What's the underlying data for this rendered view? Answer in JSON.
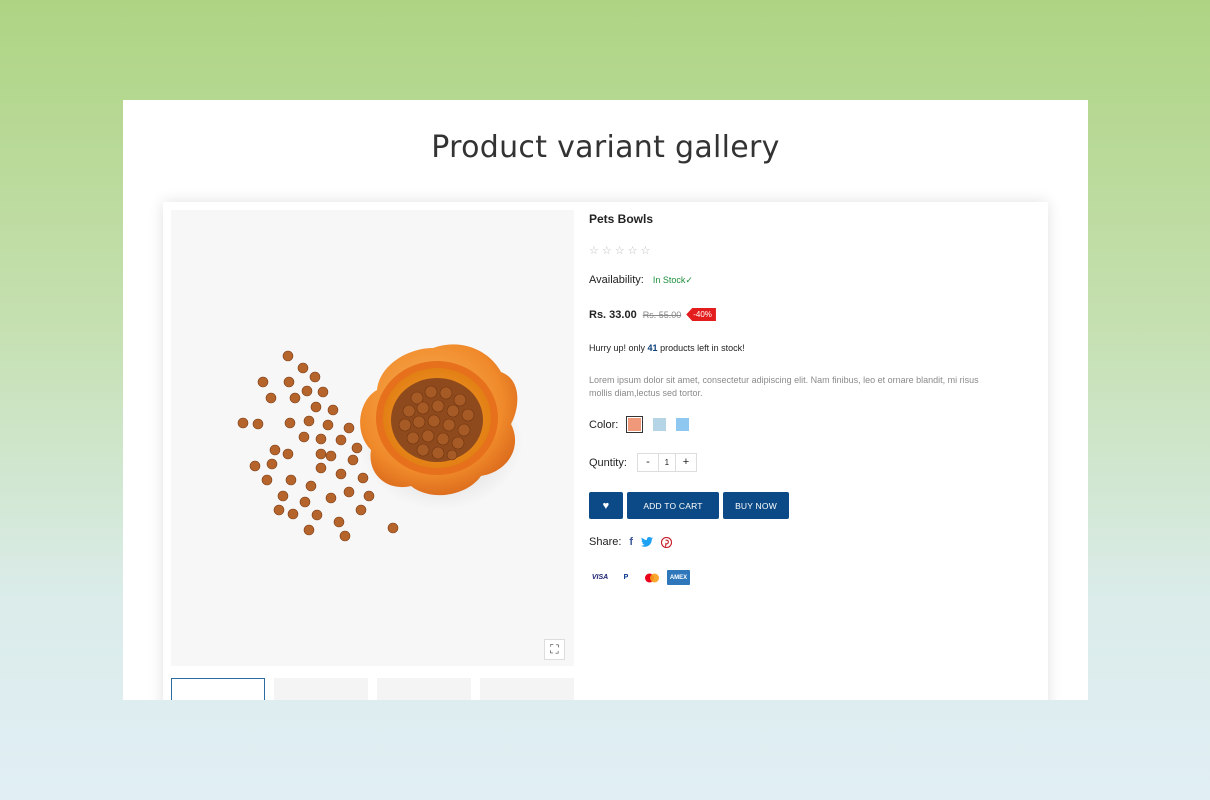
{
  "page": {
    "title": "Product variant gallery"
  },
  "product": {
    "title": "Pets Bowls",
    "rating_stars": "☆☆☆☆☆",
    "rating": 0,
    "availability_label": "Availability:",
    "availability_value": "In Stock✓",
    "price": "Rs. 33.00",
    "old_price": "Rs. 55.00",
    "discount": "-40%",
    "hurry_prefix": "Hurry up! only",
    "hurry_count": "41",
    "hurry_suffix": "products left in stock!",
    "description": "Lorem ipsum dolor sit amet, consectetur adipiscing elit. Nam finibus, leo et ornare blandit, mi risus mollis diam,lectus sed tortor.",
    "color_label": "Color:",
    "colors": [
      "#f0997a",
      "#b5d4e6",
      "#8ec8f0"
    ],
    "quantity_label": "Quntity:",
    "quantity_minus": "-",
    "quantity_value": "1",
    "quantity_plus": "+",
    "add_to_cart": "ADD TO CART",
    "buy_now": "BUY NOW",
    "share_label": "Share:",
    "share_icons": [
      "facebook-icon",
      "twitter-icon",
      "pinterest-icon"
    ],
    "payments": [
      "VISA",
      "PayPal",
      "Mastercard",
      "AMEX"
    ]
  },
  "colors": {
    "brand_button": "#0b4a86",
    "in_stock": "#1e8e3e",
    "discount": "#e31d1d"
  }
}
